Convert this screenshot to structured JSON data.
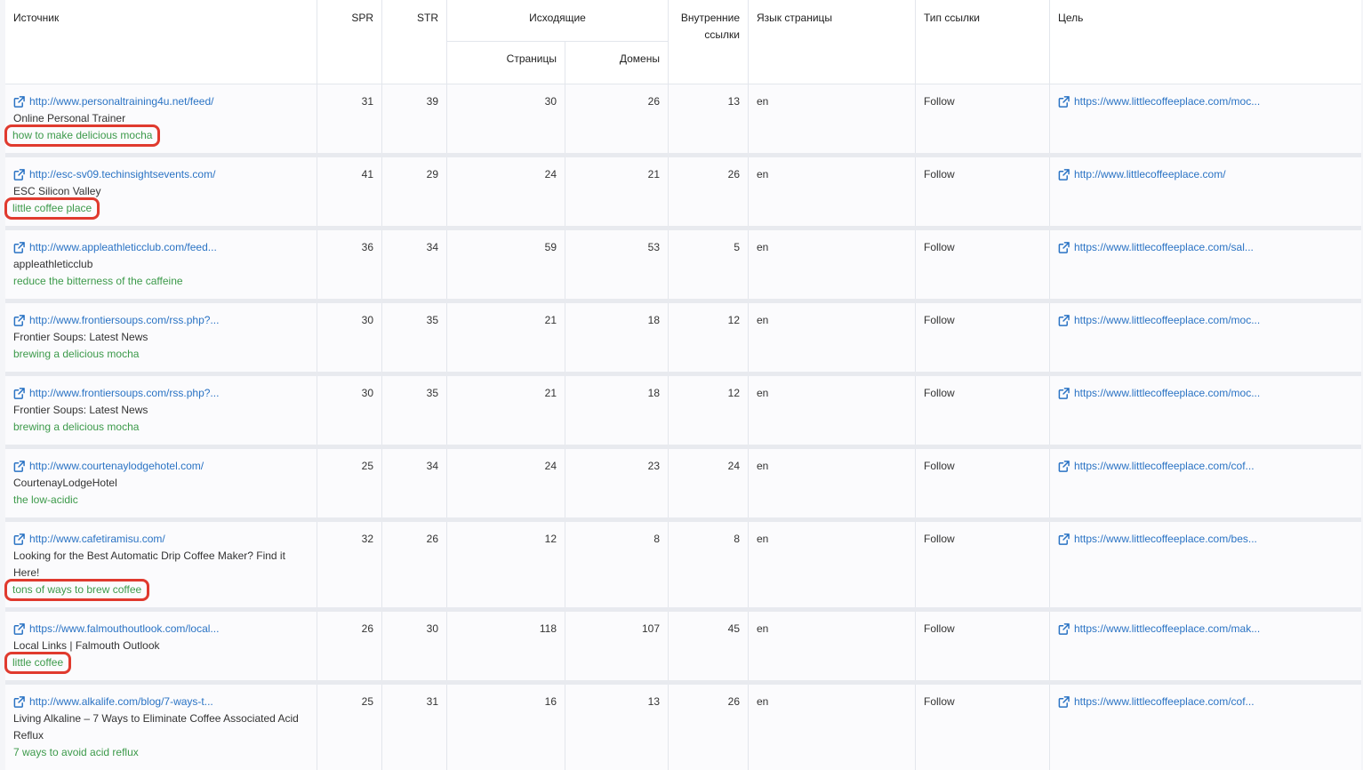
{
  "headers": {
    "source": "Источник",
    "spr": "SPR",
    "str": "STR",
    "outgoing": "Исходящие",
    "pages": "Страницы",
    "domains": "Домены",
    "internal": "Внутренние ссылки",
    "lang": "Язык страницы",
    "link_type": "Тип ссылки",
    "target": "Цель"
  },
  "colors": {
    "link": "#2a73c4",
    "anchor": "#3c9a4a",
    "highlight": "#e03a2e"
  },
  "rows": [
    {
      "url": "http://www.personaltraining4u.net/feed/",
      "title": "Online Personal Trainer",
      "anchor": "how to make delicious mocha",
      "highlighted": true,
      "spr": "31",
      "str": "39",
      "pages": "30",
      "domains": "26",
      "internal": "13",
      "lang": "en",
      "type": "Follow",
      "target": "https://www.littlecoffeeplace.com/moc..."
    },
    {
      "url": "http://esc-sv09.techinsightsevents.com/",
      "title": "ESC Silicon Valley",
      "anchor": "little coffee place",
      "highlighted": true,
      "spr": "41",
      "str": "29",
      "pages": "24",
      "domains": "21",
      "internal": "26",
      "lang": "en",
      "type": "Follow",
      "target": "http://www.littlecoffeeplace.com/"
    },
    {
      "url": "http://www.appleathleticclub.com/feed...",
      "title": "appleathleticclub",
      "anchor": "reduce the bitterness of the caffeine",
      "highlighted": false,
      "spr": "36",
      "str": "34",
      "pages": "59",
      "domains": "53",
      "internal": "5",
      "lang": "en",
      "type": "Follow",
      "target": "https://www.littlecoffeeplace.com/sal..."
    },
    {
      "url": "http://www.frontiersoups.com/rss.php?...",
      "title": "Frontier Soups: Latest News",
      "anchor": "brewing a delicious mocha",
      "highlighted": false,
      "spr": "30",
      "str": "35",
      "pages": "21",
      "domains": "18",
      "internal": "12",
      "lang": "en",
      "type": "Follow",
      "target": "https://www.littlecoffeeplace.com/moc..."
    },
    {
      "url": "http://www.frontiersoups.com/rss.php?...",
      "title": "Frontier Soups: Latest News",
      "anchor": "brewing a delicious mocha",
      "highlighted": false,
      "spr": "30",
      "str": "35",
      "pages": "21",
      "domains": "18",
      "internal": "12",
      "lang": "en",
      "type": "Follow",
      "target": "https://www.littlecoffeeplace.com/moc..."
    },
    {
      "url": "http://www.courtenaylodgehotel.com/",
      "title": "CourtenayLodgeHotel",
      "anchor": "the low-acidic",
      "highlighted": false,
      "spr": "25",
      "str": "34",
      "pages": "24",
      "domains": "23",
      "internal": "24",
      "lang": "en",
      "type": "Follow",
      "target": "https://www.littlecoffeeplace.com/cof..."
    },
    {
      "url": "http://www.cafetiramisu.com/",
      "title": "Looking for the Best Automatic Drip Coffee Maker? Find it Here!",
      "anchor": "tons of ways to brew coffee",
      "highlighted": true,
      "spr": "32",
      "str": "26",
      "pages": "12",
      "domains": "8",
      "internal": "8",
      "lang": "en",
      "type": "Follow",
      "target": "https://www.littlecoffeeplace.com/bes..."
    },
    {
      "url": "https://www.falmouthoutlook.com/local...",
      "title": "Local Links | Falmouth Outlook",
      "anchor": "little coffee",
      "highlighted": true,
      "spr": "26",
      "str": "30",
      "pages": "118",
      "domains": "107",
      "internal": "45",
      "lang": "en",
      "type": "Follow",
      "target": "https://www.littlecoffeeplace.com/mak..."
    },
    {
      "url": "http://www.alkalife.com/blog/7-ways-t...",
      "title": "Living Alkaline – 7 Ways to Eliminate Coffee Associated Acid Reflux",
      "anchor": "7 ways to avoid acid reflux",
      "highlighted": false,
      "spr": "25",
      "str": "31",
      "pages": "16",
      "domains": "13",
      "internal": "26",
      "lang": "en",
      "type": "Follow",
      "target": "https://www.littlecoffeeplace.com/cof..."
    }
  ]
}
